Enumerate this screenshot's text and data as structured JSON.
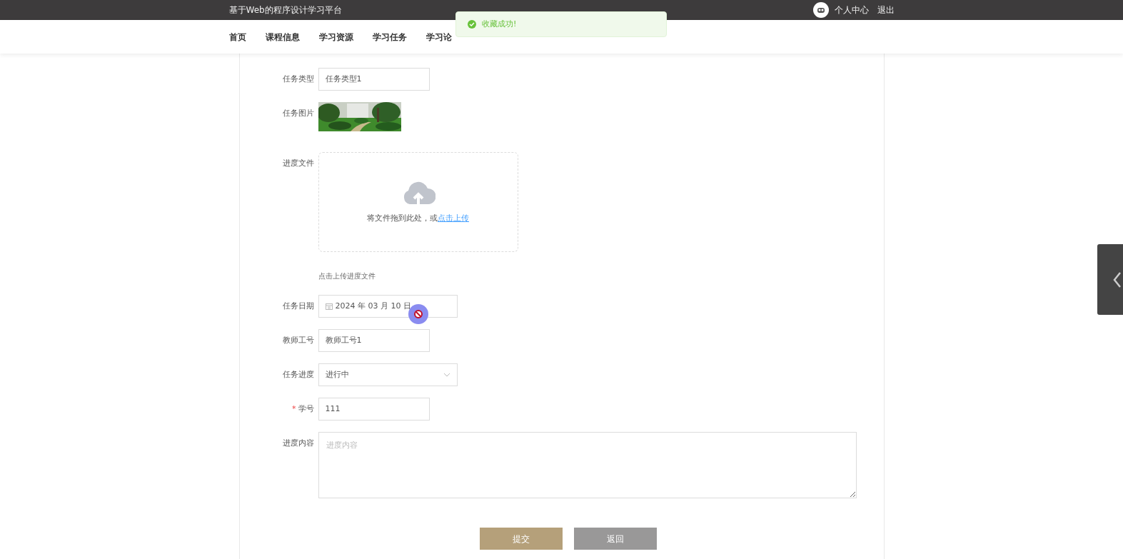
{
  "header": {
    "site_title": "基于Web的程序设计学习平台",
    "user_link": "个人中心",
    "logout": "退出"
  },
  "nav": [
    {
      "label": "首页",
      "selected": false
    },
    {
      "label": "课程信息",
      "selected": false
    },
    {
      "label": "学习资源",
      "selected": false
    },
    {
      "label": "学习任务",
      "selected": false
    },
    {
      "label": "学习论",
      "selected": false
    }
  ],
  "toast": {
    "kind": "success",
    "message": "收藏成功!"
  },
  "form": [
    {
      "kind": "text",
      "label": "任务类型",
      "value": "任务类型1"
    },
    {
      "label": "任务图片"
    },
    {
      "kind": "upload",
      "label": "进度文件",
      "text": "将文件拖到此处，或",
      "link": "点击上传",
      "hint": "点击上传进度文件"
    },
    {
      "kind": "date",
      "label": "任务日期",
      "value": "2024 年 03 月 10 日"
    },
    {
      "kind": "text",
      "label": "教师工号",
      "value": "教师工号1"
    },
    {
      "kind": "select",
      "label": "任务进度",
      "value": "进行中"
    },
    {
      "kind": "text",
      "label": "学号",
      "value": "111",
      "required_mark": "*"
    },
    {
      "kind": "textarea",
      "label": "进度内容",
      "placeholder": "进度内容"
    }
  ],
  "buttons": [
    {
      "label": "提交",
      "kind": "primary"
    },
    {
      "label": "返回",
      "kind": "secondary"
    }
  ]
}
